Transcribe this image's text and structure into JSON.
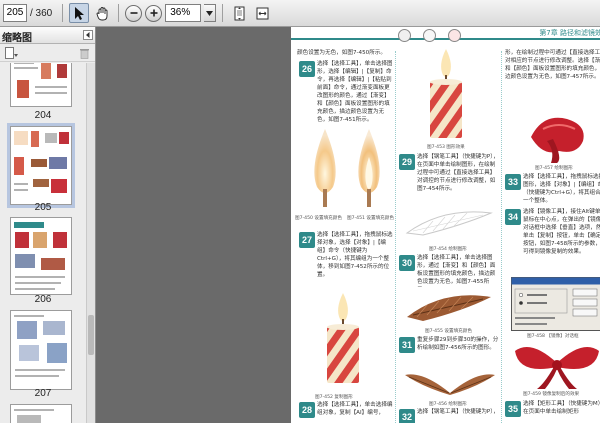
{
  "toolbar": {
    "current_page": "205",
    "page_total": "/ 360",
    "zoom": "36%",
    "icons": [
      "select-arrow-icon",
      "hand-icon",
      "zoom-out-icon",
      "zoom-in-icon",
      "fit-page-icon",
      "fit-width-icon"
    ]
  },
  "sidebar": {
    "title": "缩略图",
    "thumbnails": [
      {
        "label": "204"
      },
      {
        "label": "205"
      },
      {
        "label": "206"
      },
      {
        "label": "207"
      }
    ]
  },
  "page": {
    "header": "第7章  路径和滤镜效果",
    "steps": {
      "s26": "26",
      "s27": "27",
      "s28": "28",
      "s29": "29",
      "s30": "30",
      "s31": "31",
      "s32": "32",
      "s33": "33",
      "s34": "34",
      "s35": "35"
    },
    "texts": {
      "top_left": "颜色设置为无色，如图7-450所示。",
      "p26": "选择【选择工具】，单击选择图形，选择【编辑】|【复制】命令，再选择【编辑】|【粘贴到前面】命令，通过渐变面板更改图形的颜色，通过【渐变】和【颜色】面板设置图形的填充颜色，描边颜色设置为无色，如图7-451所示。",
      "p27": "选择【选择工具】，拖拽鼠标选择对象，选择【对象】|【编组】命令（快捷键为Ctrl+G），将其编组为一个整体，移到如图7-452所示的位置。",
      "p28": "选择【选择工具】，单击选择编组对象，复制【AI】编号，",
      "p29": "选择【钢笔工具】（快捷键为P），在页面中单击绘制图形，在绘制过程中可通过【直接选择工具】对调控的节点进行修改调整，如图7-454所示。",
      "p30": "选择【选择工具】，单击选择图形，通过【渐变】和【颜色】面板设置图形的填充颜色，描边颜色设置为无色，如图7-455所示。",
      "p31": "重复步骤29到步骤30的操作，分析绘制如图7-456所示的图形。",
      "p32": "选择【钢笔工具】（快捷键为P），",
      "top_right": "形，在绘制过程中可通过【直接选择工具】对相应的节点进行修改调整。选择【渐变】和【颜色】面板设置图形的填充颜色，描边颜色设置为无色，如图7-457所示。",
      "p33": "选择【选择工具】，拖拽鼠标选择图形，选择【对象】|【编组】命令（快捷键为Ctrl+G），将其组合为一个整体。",
      "p34": "选择【镜像工具】，接住Alt键单击鼠标在中心点，在弹出的【镜像】对话框中选择【垂直】选项，然后单击【复制】按钮，单击【确定】按钮，如图7-458所示的参数，即可得到镜像复制的效果。",
      "p35": "选择【矩形工具】（快捷键为M），在页面中单击绘制矩形"
    },
    "captions": {
      "c450": "图7-450  设置填充颜色",
      "c451": "图7-451  设置填充颜色",
      "c452": "图7-452  复制图形",
      "c453": "图7-453  图形效果",
      "c454": "图7-454  绘制图形",
      "c455": "图7-455  设置填充颜色",
      "c456": "图7-456  绘制图形",
      "c457": "图7-457  绘制图形",
      "c458": "图7-458  【镜像】对话框",
      "c459": "图7-459  镜像复制后的效果"
    }
  }
}
